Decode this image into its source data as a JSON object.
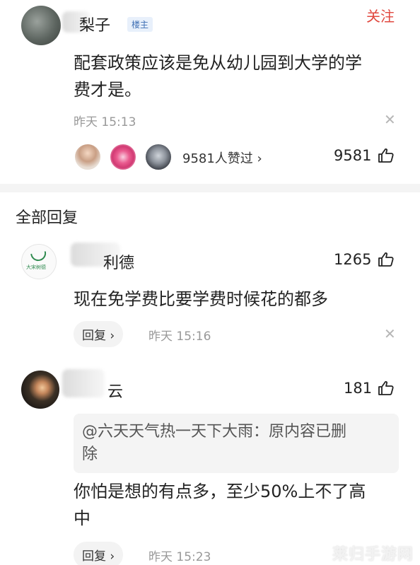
{
  "post": {
    "author_name": "梨子",
    "badge": "楼主",
    "follow_label": "关注",
    "content_line1": "配套政策应该是免从幼儿园到大学的学",
    "content_line2": "费才是。",
    "time": "昨天  15:13",
    "close": "✕",
    "likes_summary": "9581人赞过 ›",
    "like_count": "9581"
  },
  "replies_section": {
    "title": "全部回复"
  },
  "replies": [
    {
      "author_name": "利德",
      "avatar_text": "大宋树德",
      "like_count": "1265",
      "content": "现在免学费比要学费时候花的都多",
      "reply_label": "回复 ›",
      "time": "昨天  15:16",
      "close": "✕"
    },
    {
      "author_name": "云",
      "like_count": "181",
      "quote_line1": "@六天天气热一天下大雨：原内容已删",
      "quote_line2": "除",
      "content_line1": "你怕是想的有点多，至少50%上不了高",
      "content_line2": "中",
      "reply_label": "回复 ›",
      "time": "昨天  15:23"
    }
  ],
  "watermark": "莱归手游网",
  "icons": {
    "thumb": "thumbs-up-icon",
    "close": "close-icon"
  },
  "colors": {
    "follow": "#e0483f",
    "badge": "#3f6fb4"
  }
}
